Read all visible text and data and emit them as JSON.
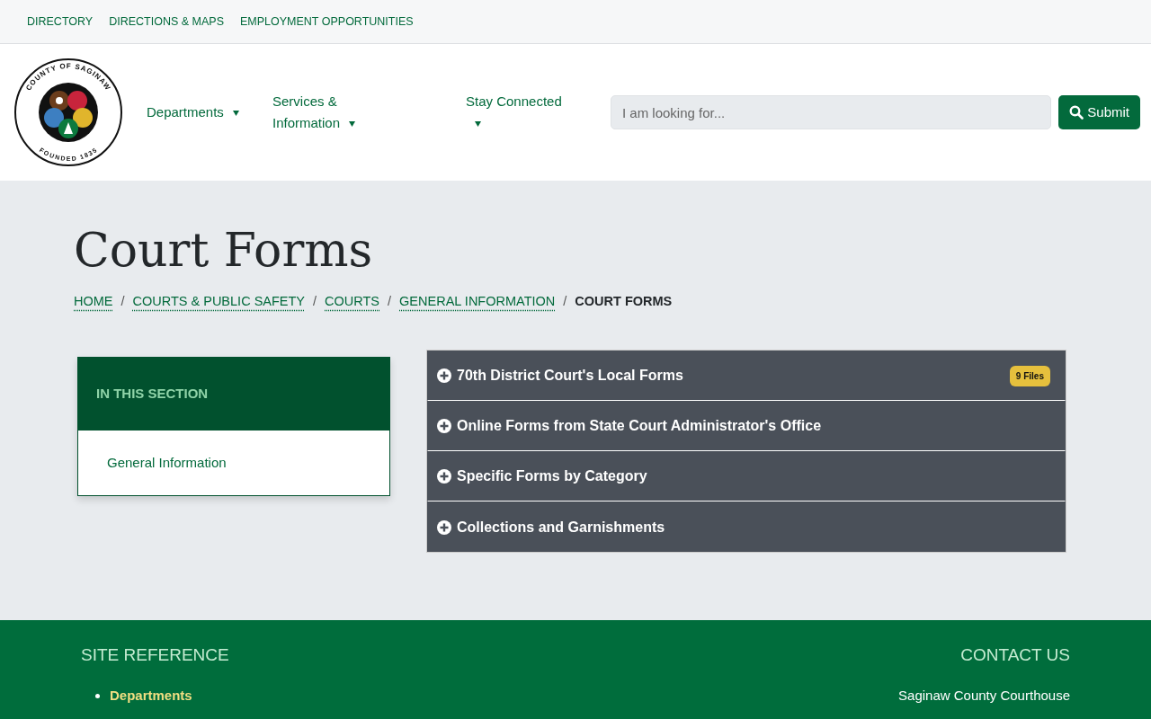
{
  "utility_nav": [
    "DIRECTORY",
    "DIRECTIONS & MAPS",
    "EMPLOYMENT OPPORTUNITIES"
  ],
  "logo": {
    "top_text": "COUNTY OF SAGINAW",
    "bottom_text": "FOUNDED 1835"
  },
  "main_nav": [
    {
      "label": "Departments",
      "has_menu": true
    },
    {
      "label": "Services & Information",
      "has_menu": true
    },
    {
      "label": "Stay Connected",
      "has_menu": true
    }
  ],
  "search": {
    "placeholder": "I am looking for...",
    "button": "Submit"
  },
  "page_title": "Court Forms",
  "breadcrumb": [
    {
      "label": "HOME",
      "current": false
    },
    {
      "label": "COURTS & PUBLIC SAFETY",
      "current": false
    },
    {
      "label": "COURTS",
      "current": false
    },
    {
      "label": "GENERAL INFORMATION",
      "current": false
    },
    {
      "label": "COURT FORMS",
      "current": true
    }
  ],
  "breadcrumb_separator": "/",
  "section_nav": {
    "heading": "IN THIS SECTION",
    "items": [
      "General Information"
    ]
  },
  "accordion": [
    {
      "title": "70th District Court's Local Forms",
      "expanded": false,
      "badge": "9 Files"
    },
    {
      "title": "Online Forms from State Court Administrator's Office",
      "expanded": false
    },
    {
      "title": "Specific Forms by Category",
      "expanded": false
    },
    {
      "title": "Collections and Garnishments",
      "expanded": false
    }
  ],
  "footer": {
    "site_reference": {
      "heading": "SITE REFERENCE",
      "links": [
        "Departments"
      ]
    },
    "contact": {
      "heading": "CONTACT US",
      "lines": [
        "Saginaw County Courthouse"
      ]
    }
  }
}
